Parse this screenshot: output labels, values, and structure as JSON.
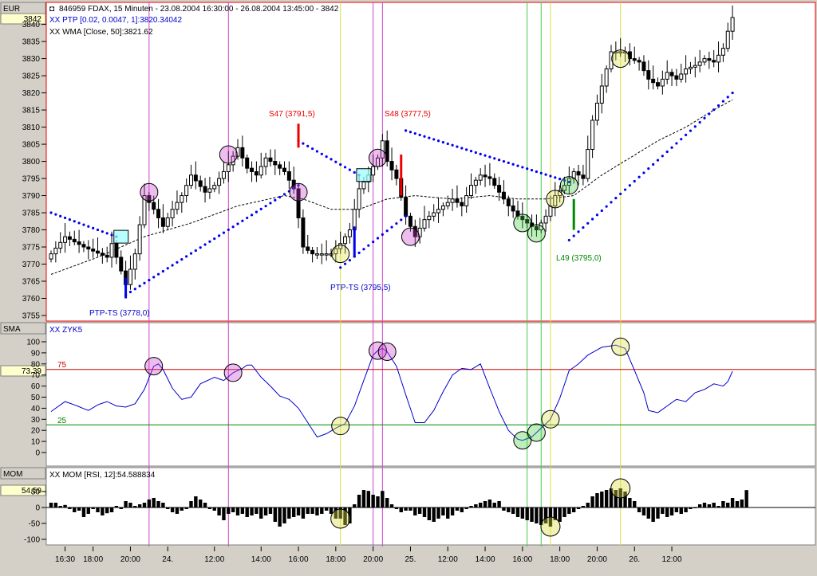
{
  "main": {
    "currency_label": "EUR",
    "current_value": "3842",
    "info_lines": [
      "846959  FDAX, 15 Minuten - 23.08.2004 16:30:00 - 26.08.2004 13:45:00 - 3842",
      "XX PTP [0.02, 0.0047, 1]:3820.34042",
      "XX WMA [Close, 50]:3821.62"
    ],
    "annotations": {
      "s47": "S47 (3791,5)",
      "s48": "S48 (3777,5)",
      "ptp1": "PTP-TS (3778,0)",
      "ptp2": "PTP-TS (3795,5)",
      "l49": "L49 (3795,0)"
    }
  },
  "sma": {
    "panel_label": "SMA",
    "legend": "XX   ZYK5",
    "current_value": "73.39",
    "level_labels": [
      "75",
      "25"
    ]
  },
  "mom": {
    "panel_label": "MOM",
    "legend": "XX MOM [RSI, 12]:54.588834",
    "current_value": "54.59"
  },
  "time_labels": [
    "16:30",
    "18:00",
    "20:00",
    "24.",
    "12:00",
    "14:00",
    "16:00",
    "18:00",
    "20:00",
    "25.",
    "12:00",
    "14:00",
    "16:00",
    "18:00",
    "20:00",
    "26.",
    "12:00"
  ],
  "colors": {
    "up_candle": "#ffffff",
    "down_candle": "#000000",
    "ptp_dots": "#0000ee",
    "wma_line": "#000000",
    "sma_line": "#0000cc",
    "sell_signal": "#ee0000",
    "buy_signal": "#008800",
    "magenta_marker": "#cc44cc",
    "yellow_marker": "#dddd44",
    "green_marker": "#44cc44",
    "line_75": "#cc0000",
    "line_25": "#008800"
  },
  "chart_data": [
    {
      "type": "candlestick",
      "title": "846959  FDAX, 15 Minuten - 23.08.2004 16:30:00 - 26.08.2004 13:45:00 - 3842",
      "ylabel": "EUR",
      "ylim": [
        3753,
        3846
      ],
      "y_ticks": [
        3755,
        3760,
        3765,
        3770,
        3775,
        3780,
        3785,
        3790,
        3795,
        3800,
        3805,
        3810,
        3815,
        3820,
        3825,
        3830,
        3835,
        3840
      ],
      "x_ticks": [
        "16:30",
        "18:00",
        "20:00",
        "24.",
        "12:00",
        "14:00",
        "16:00",
        "18:00",
        "20:00",
        "25.",
        "12:00",
        "14:00",
        "16:00",
        "18:00",
        "20:00",
        "26.",
        "12:00"
      ],
      "close_anchors": [
        [
          0,
          3773
        ],
        [
          3,
          3778
        ],
        [
          7,
          3775
        ],
        [
          12,
          3772
        ],
        [
          13,
          3776
        ],
        [
          16,
          3764
        ],
        [
          18,
          3773
        ],
        [
          20,
          3790
        ],
        [
          22,
          3786
        ],
        [
          24,
          3781
        ],
        [
          26,
          3786
        ],
        [
          28,
          3790
        ],
        [
          30,
          3796
        ],
        [
          33,
          3791
        ],
        [
          35,
          3793
        ],
        [
          38,
          3799
        ],
        [
          40,
          3804
        ],
        [
          42,
          3798
        ],
        [
          44,
          3796
        ],
        [
          46,
          3801
        ],
        [
          50,
          3797
        ],
        [
          52,
          3792
        ],
        [
          54,
          3775
        ],
        [
          56,
          3773
        ],
        [
          58,
          3773
        ],
        [
          60,
          3773
        ],
        [
          62,
          3776
        ],
        [
          64,
          3780
        ],
        [
          66,
          3792
        ],
        [
          68,
          3796
        ],
        [
          70,
          3801
        ],
        [
          71,
          3806
        ],
        [
          72,
          3800
        ],
        [
          74,
          3795
        ],
        [
          76,
          3784
        ],
        [
          78,
          3778
        ],
        [
          80,
          3783
        ],
        [
          84,
          3787
        ],
        [
          86,
          3789
        ],
        [
          88,
          3787
        ],
        [
          90,
          3793
        ],
        [
          92,
          3796
        ],
        [
          94,
          3795
        ],
        [
          96,
          3791
        ],
        [
          98,
          3787
        ],
        [
          100,
          3784
        ],
        [
          102,
          3782
        ],
        [
          104,
          3780
        ],
        [
          106,
          3784
        ],
        [
          108,
          3790
        ],
        [
          110,
          3793
        ],
        [
          112,
          3797
        ],
        [
          114,
          3795
        ],
        [
          116,
          3812
        ],
        [
          118,
          3822
        ],
        [
          120,
          3832
        ],
        [
          123,
          3832
        ],
        [
          124,
          3830
        ],
        [
          126,
          3829
        ],
        [
          128,
          3824
        ],
        [
          130,
          3822
        ],
        [
          132,
          3826
        ],
        [
          134,
          3824
        ],
        [
          136,
          3827
        ],
        [
          138,
          3828
        ],
        [
          140,
          3830
        ],
        [
          142,
          3829
        ],
        [
          144,
          3833
        ],
        [
          145,
          3838
        ],
        [
          146,
          3842
        ]
      ],
      "ptp_segments": [
        {
          "points": [
            [
              0,
              3785
            ],
            [
              14,
              3778
            ]
          ],
          "label": ""
        },
        {
          "points": [
            [
              16,
              3761
            ],
            [
              53,
              3793
            ]
          ],
          "label": "PTP-TS (3778,0)"
        },
        {
          "points": [
            [
              53,
              3806
            ],
            [
              66,
              3796
            ]
          ],
          "label": "S47 (3791,5)"
        },
        {
          "points": [
            [
              62,
              3769
            ],
            [
              76,
              3784
            ]
          ],
          "label": "PTP-TS (3795,5)"
        },
        {
          "points": [
            [
              76,
              3809
            ],
            [
              111,
              3794
            ]
          ],
          "label": "S48 (3777,5)"
        },
        {
          "points": [
            [
              111,
              3777
            ],
            [
              146,
              3820
            ]
          ],
          "label": "L49 (3795,0)"
        }
      ],
      "wma_anchors": [
        [
          0,
          3767
        ],
        [
          10,
          3772
        ],
        [
          20,
          3778
        ],
        [
          30,
          3782
        ],
        [
          40,
          3787
        ],
        [
          50,
          3790
        ],
        [
          54,
          3789
        ],
        [
          60,
          3786
        ],
        [
          66,
          3786
        ],
        [
          72,
          3789
        ],
        [
          78,
          3790
        ],
        [
          86,
          3789
        ],
        [
          94,
          3790
        ],
        [
          100,
          3789
        ],
        [
          106,
          3789
        ],
        [
          112,
          3790
        ],
        [
          118,
          3796
        ],
        [
          124,
          3801
        ],
        [
          130,
          3806
        ],
        [
          136,
          3810
        ],
        [
          142,
          3815
        ],
        [
          146,
          3818
        ]
      ],
      "signals": [
        {
          "label": "S47 (3791,5)",
          "type": "sell",
          "index": 53,
          "y_range": [
            3804,
            3811
          ]
        },
        {
          "label": "S48 (3777,5)",
          "type": "sell",
          "index": 75,
          "y_range": [
            3790,
            3802
          ]
        },
        {
          "label": "PTP-TS (3778,0)",
          "type": "buy",
          "index": 16,
          "y_range": [
            3760,
            3766
          ]
        },
        {
          "label": "PTP-TS (3795,5)",
          "type": "buy",
          "index": 65,
          "y_range": [
            3772,
            3781
          ]
        },
        {
          "label": "L49 (3795,0)",
          "type": "buy",
          "index": 112,
          "y_range": [
            3780,
            3789
          ]
        }
      ]
    },
    {
      "type": "line",
      "title": "SMA",
      "series": [
        {
          "name": "ZYK5",
          "anchors": [
            [
              0,
              37
            ],
            [
              3,
              46
            ],
            [
              5,
              43
            ],
            [
              8,
              38
            ],
            [
              10,
              43
            ],
            [
              12,
              46
            ],
            [
              14,
              42
            ],
            [
              16,
              41
            ],
            [
              18,
              44
            ],
            [
              20,
              57
            ],
            [
              22,
              78
            ],
            [
              23,
              80
            ],
            [
              24,
              75
            ],
            [
              26,
              58
            ],
            [
              28,
              48
            ],
            [
              30,
              50
            ],
            [
              32,
              62
            ],
            [
              35,
              68
            ],
            [
              37,
              65
            ],
            [
              39,
              72
            ],
            [
              41,
              76
            ],
            [
              42,
              79
            ],
            [
              43,
              79
            ],
            [
              45,
              68
            ],
            [
              47,
              60
            ],
            [
              49,
              51
            ],
            [
              51,
              48
            ],
            [
              53,
              40
            ],
            [
              55,
              27
            ],
            [
              57,
              14
            ],
            [
              59,
              17
            ],
            [
              61,
              22
            ],
            [
              63,
              26
            ],
            [
              65,
              42
            ],
            [
              67,
              65
            ],
            [
              69,
              88
            ],
            [
              70,
              92
            ],
            [
              71,
              94
            ],
            [
              72,
              91
            ],
            [
              74,
              78
            ],
            [
              76,
              52
            ],
            [
              78,
              27
            ],
            [
              80,
              27
            ],
            [
              82,
              38
            ],
            [
              84,
              55
            ],
            [
              86,
              70
            ],
            [
              88,
              76
            ],
            [
              90,
              75
            ],
            [
              92,
              80
            ],
            [
              94,
              58
            ],
            [
              96,
              37
            ],
            [
              98,
              20
            ],
            [
              100,
              12
            ],
            [
              101,
              11
            ],
            [
              103,
              14
            ],
            [
              105,
              22
            ],
            [
              107,
              30
            ],
            [
              109,
              49
            ],
            [
              111,
              74
            ],
            [
              113,
              80
            ],
            [
              115,
              88
            ],
            [
              118,
              95
            ],
            [
              121,
              97
            ],
            [
              123,
              94
            ],
            [
              125,
              74
            ],
            [
              127,
              54
            ],
            [
              128,
              38
            ],
            [
              130,
              36
            ],
            [
              132,
              42
            ],
            [
              134,
              48
            ],
            [
              136,
              46
            ],
            [
              138,
              54
            ],
            [
              140,
              57
            ],
            [
              142,
              62
            ],
            [
              144,
              60
            ],
            [
              145,
              64
            ],
            [
              146,
              73.39
            ]
          ]
        }
      ],
      "ylim": [
        -5,
        105
      ],
      "y_ticks": [
        0,
        10,
        20,
        30,
        40,
        50,
        60,
        70,
        80,
        90,
        100
      ],
      "levels": [
        75,
        25
      ],
      "current": 73.39
    },
    {
      "type": "bar",
      "title": "MOM",
      "series": [
        {
          "name": "MOM [RSI, 12]",
          "values": [
            15,
            15,
            5,
            8,
            -5,
            -15,
            -10,
            -30,
            -20,
            -5,
            -15,
            -25,
            -18,
            -15,
            5,
            -5,
            20,
            15,
            5,
            10,
            15,
            25,
            30,
            20,
            15,
            -5,
            -15,
            -20,
            -10,
            -5,
            20,
            35,
            25,
            15,
            -5,
            -10,
            -25,
            -40,
            -20,
            -15,
            -25,
            -20,
            -30,
            -25,
            -20,
            -35,
            -25,
            -20,
            -45,
            -60,
            -50,
            -35,
            -30,
            -25,
            -35,
            -20,
            -20,
            -25,
            -20,
            -10,
            -20,
            -35,
            -35,
            -55,
            -50,
            10,
            40,
            55,
            52,
            40,
            35,
            52,
            30,
            10,
            -5,
            -15,
            -10,
            -10,
            -25,
            -20,
            -30,
            -40,
            -45,
            -35,
            -25,
            -35,
            -25,
            -10,
            -15,
            -5,
            5,
            10,
            15,
            20,
            25,
            15,
            20,
            -10,
            -15,
            -20,
            -30,
            -35,
            -40,
            -45,
            -50,
            -55,
            -50,
            -60,
            -40,
            -45,
            -30,
            -20,
            -15,
            -5,
            5,
            15,
            35,
            45,
            50,
            55,
            60,
            55,
            60,
            50,
            30,
            20,
            -15,
            -25,
            -35,
            -45,
            -35,
            -20,
            -30,
            -25,
            -15,
            -20,
            -15,
            -5,
            0,
            10,
            15,
            10,
            15,
            5,
            20,
            15,
            30,
            20,
            25,
            54.59
          ]
        }
      ],
      "ylim": [
        -110,
        80
      ],
      "y_ticks": [
        -100,
        -50,
        0,
        50
      ],
      "current": 54.59
    }
  ]
}
